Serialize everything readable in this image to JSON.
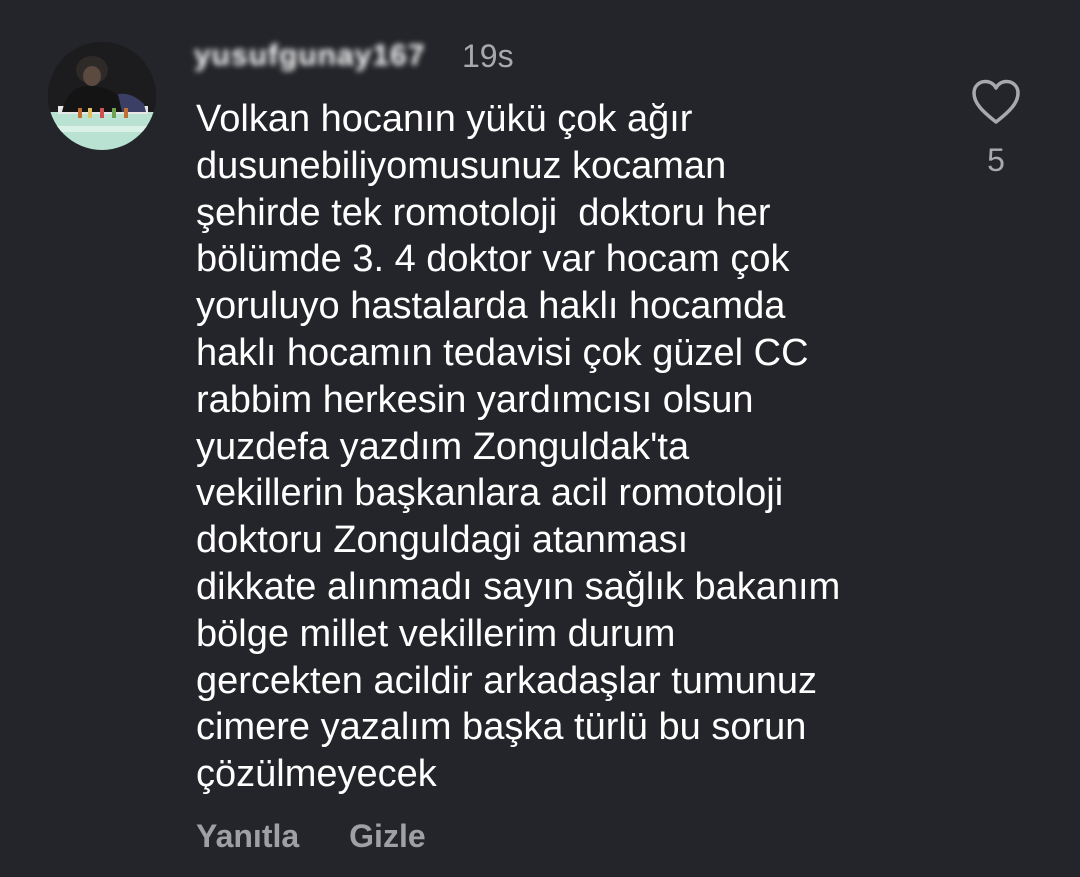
{
  "comment": {
    "username": "yusufgunay167",
    "timestamp": "19s",
    "text": "Volkan hocanın yükü çok ağır\ndusunebiliyomusunuz kocaman\nşehirde tek romotoloji  doktoru her\nbölümde 3. 4 doktor var hocam çok\nyoruluyo hastalarda haklı hocamda\nhaklı hocamın tedavisi çok güzel CC\nrabbim herkesin yardımcısı olsun\nyuzdefa yazdım Zonguldak'ta\nvekillerin başkanlara acil romotoloji\ndoktoru Zonguldagi atanması\ndikkate alınmadı sayın sağlık bakanım\nbölge millet vekillerim durum\ngercekten acildir arkadaşlar tumunuz\ncimere yazalım başka türlü bu sorun\nçözülmeyecek",
    "reply_label": "Yanıtla",
    "hide_label": "Gizle",
    "like_count": "5"
  },
  "icons": {
    "like": "heart-outline-icon",
    "avatar": "user-avatar-photo"
  },
  "colors": {
    "background": "#24252a",
    "primary_text": "#ffffff",
    "secondary_text": "#a8a9ad",
    "action_text": "#9fa0a4"
  }
}
